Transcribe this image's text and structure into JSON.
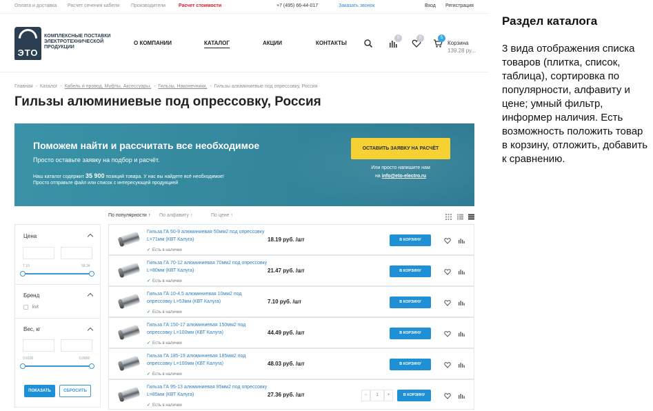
{
  "topbar": {
    "payment": "Оплата и доставка",
    "cable_calc": "Расчет сечения кабеля",
    "manufacturers": "Производители",
    "cost_calc": "Расчет стоимости",
    "phone": "+7 (495) 66-44-017",
    "callback": "Заказать звонок",
    "login": "Вход",
    "register": "Регистрация"
  },
  "header": {
    "logo_mark": "ЭТО",
    "logo_text": "Комплексные поставки электротехнической продукции",
    "nav": [
      "О КОМПАНИИ",
      "КАТАЛОГ",
      "АКЦИИ",
      "КОНТАКТЫ"
    ],
    "compare_count": "0",
    "favorites_count": "0",
    "cart_count": "5",
    "cart_label": "Корзина",
    "cart_sum": "139.28 ру..."
  },
  "breadcrumbs": [
    "Главная",
    "-",
    "Каталог",
    "-",
    "Кабель и провод, Муфты, Аксессуары,",
    "-",
    "Гильзы, Наконечники,",
    "-",
    "Гильзы алюминиевые под опрессовку, Россия"
  ],
  "page_title": "Гильзы алюминиевые под опрессовку, Россия",
  "banner": {
    "headline": "Поможем найти и рассчитать все необходимое",
    "subline": "Просто оставьте заявку на подбор и расчёт.",
    "line1_pre": "Наш каталог содержит ",
    "line1_num": "35 900",
    "line1_post": " позиций товара. У нас вы найдете всё необходимое!",
    "line2": "Просто отправьте файл или список с интересующей продукцией",
    "button": "Оставить заявку на расчёт",
    "or_text": "Или просто напишите нам",
    "mail_pre": "на ",
    "mail": "info@eto-electro.ru"
  },
  "sorting": {
    "popularity": "По популярности ↑",
    "alphabet": "По алфавиту ↑",
    "price": "По цене ↑"
  },
  "filter": {
    "price_label": "Цена",
    "price_min": "7.10",
    "price_max": "58.34",
    "brand_label": "Бренд",
    "brand_item": "kvt",
    "weight_label": "Вес, кг",
    "weight_min": "0.0100",
    "weight_max": "0.0800",
    "show_button": "Показать",
    "reset_button": "Сбросить"
  },
  "products": [
    {
      "name": "Гильза ГА 50-9 алюминиевая 50мм2 под опрессовку L=71мм (КВТ Калуга)",
      "price": "18.19 руб. /шт",
      "stock": "Есть в наличии",
      "cart": "В корзину"
    },
    {
      "name": "Гильза ГА 70-12 алюминиевая 70мм2 под опрессовку L=80мм (КВТ Калуга)",
      "price": "21.47 руб. /шт",
      "stock": "Есть в наличии",
      "cart": "В корзину"
    },
    {
      "name": "Гильза ГА 10-4,5 алюминиевая 10мм2 под опрессовку L=53мм (КВТ Калуга)",
      "price": "7.10 руб. /шт",
      "stock": "Есть в наличии",
      "cart": "В корзину"
    },
    {
      "name": "Гильза ГА 150-17 алюминиевая 150мм2 под опрессовку L=100мм (КВТ Калуга)",
      "price": "44.49 руб. /шт",
      "stock": "Есть в наличии",
      "cart": "В корзину"
    },
    {
      "name": "Гильза ГА 185-19 алюминиевая 185мм2 под опрессовку L=100мм (КВТ Калуга)",
      "price": "48.03 руб. /шт",
      "stock": "Есть в наличии",
      "cart": "В корзину"
    },
    {
      "name": "Гильза ГА 95-13 алюминиевая 95мм2 под опрессовку L=85мм (КВТ Калуга)",
      "price": "27.36 руб. /шт",
      "stock": "Есть в наличии",
      "cart": "В корзину"
    }
  ],
  "qty": {
    "minus": "−",
    "value": "1",
    "plus": "+"
  },
  "side_note": {
    "title": "Раздел каталога",
    "text": "3 вида отображения списка товаров (плитка, список, таблица), сортировка по популярности, алфавиту и цене; умный фильтр, информер наличия. Есть возможность положить товар в корзину, отложить, добавить к сравнению."
  },
  "colors": {
    "accent_blue": "#1f8fd6",
    "banner_teal": "#3a93a8",
    "cta_yellow": "#f5d133",
    "highlight_red": "#d0202e",
    "stock_green": "#2aa845"
  },
  "icons": [
    "search-icon",
    "compare-icon",
    "heart-icon",
    "cart-icon",
    "grid-view-icon",
    "list-view-icon",
    "table-view-icon",
    "check-icon",
    "chevron-up-icon"
  ]
}
